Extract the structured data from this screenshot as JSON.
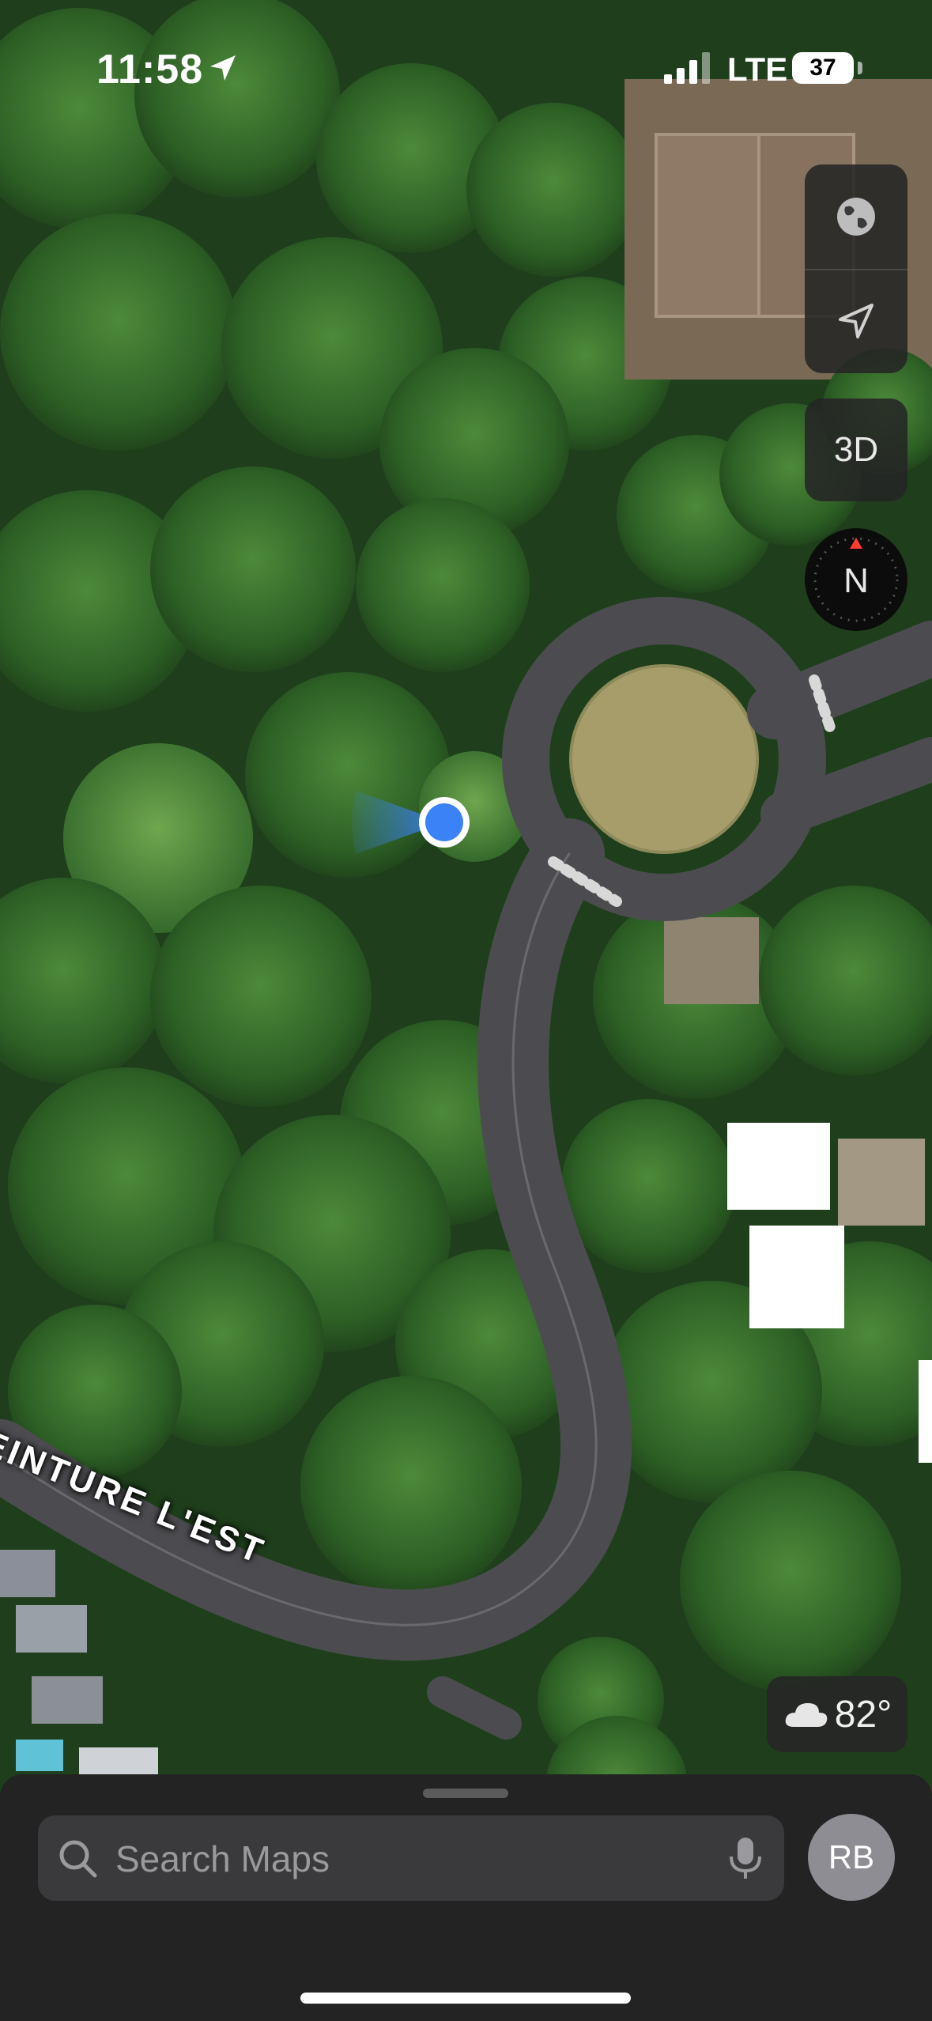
{
  "status_bar": {
    "time": "11:58",
    "network": "LTE",
    "battery": "37"
  },
  "controls": {
    "map_mode_icon": "globe-icon",
    "location_icon": "location-arrow-icon",
    "three_d_label": "3D",
    "compass_label": "N"
  },
  "map": {
    "road_label": "EINTURE L'EST",
    "user_location_color": "#3b82f6"
  },
  "weather": {
    "icon": "cloud-icon",
    "temperature": "82°"
  },
  "search": {
    "placeholder": "Search Maps",
    "value": ""
  },
  "profile": {
    "initials": "RB"
  }
}
